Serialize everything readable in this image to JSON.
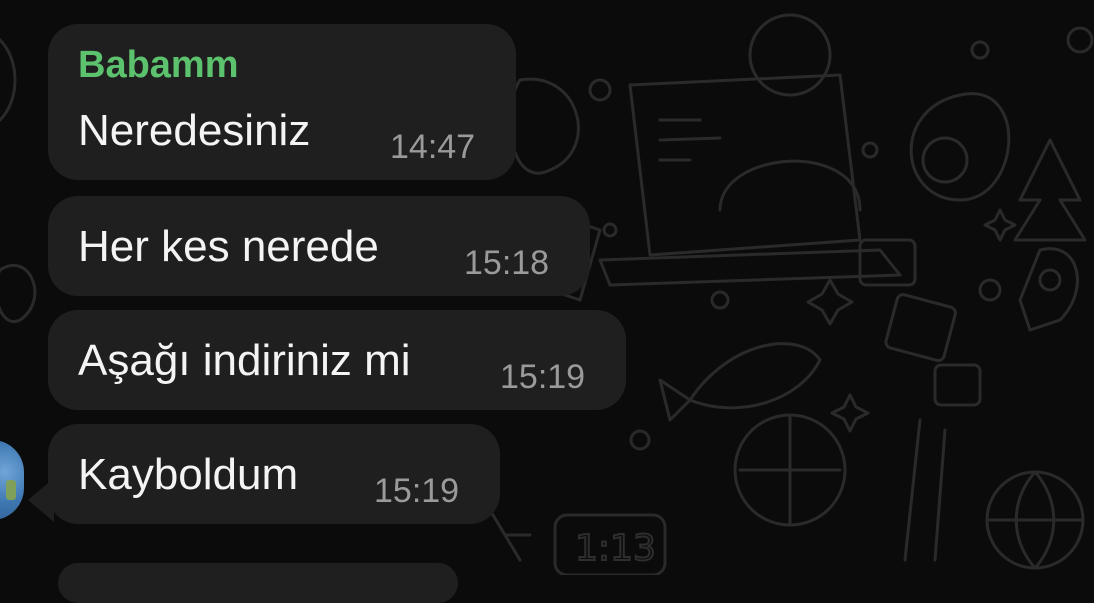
{
  "chat": {
    "messages": [
      {
        "sender": "Babamm",
        "text": "Neredesiniz",
        "time": "14:47"
      },
      {
        "text": "Her kes nerede",
        "time": "15:18"
      },
      {
        "text": "Aşağı indiriniz mi",
        "time": "15:19"
      },
      {
        "text": "Kayboldum",
        "time": "15:19"
      }
    ],
    "background_doodle_text": "1:13"
  },
  "colors": {
    "background": "#0b0b0b",
    "bubble": "#1f1f1f",
    "sender_name": "#5cc26d",
    "message_text": "#f4f4f4",
    "timestamp": "#9a9a9a"
  }
}
